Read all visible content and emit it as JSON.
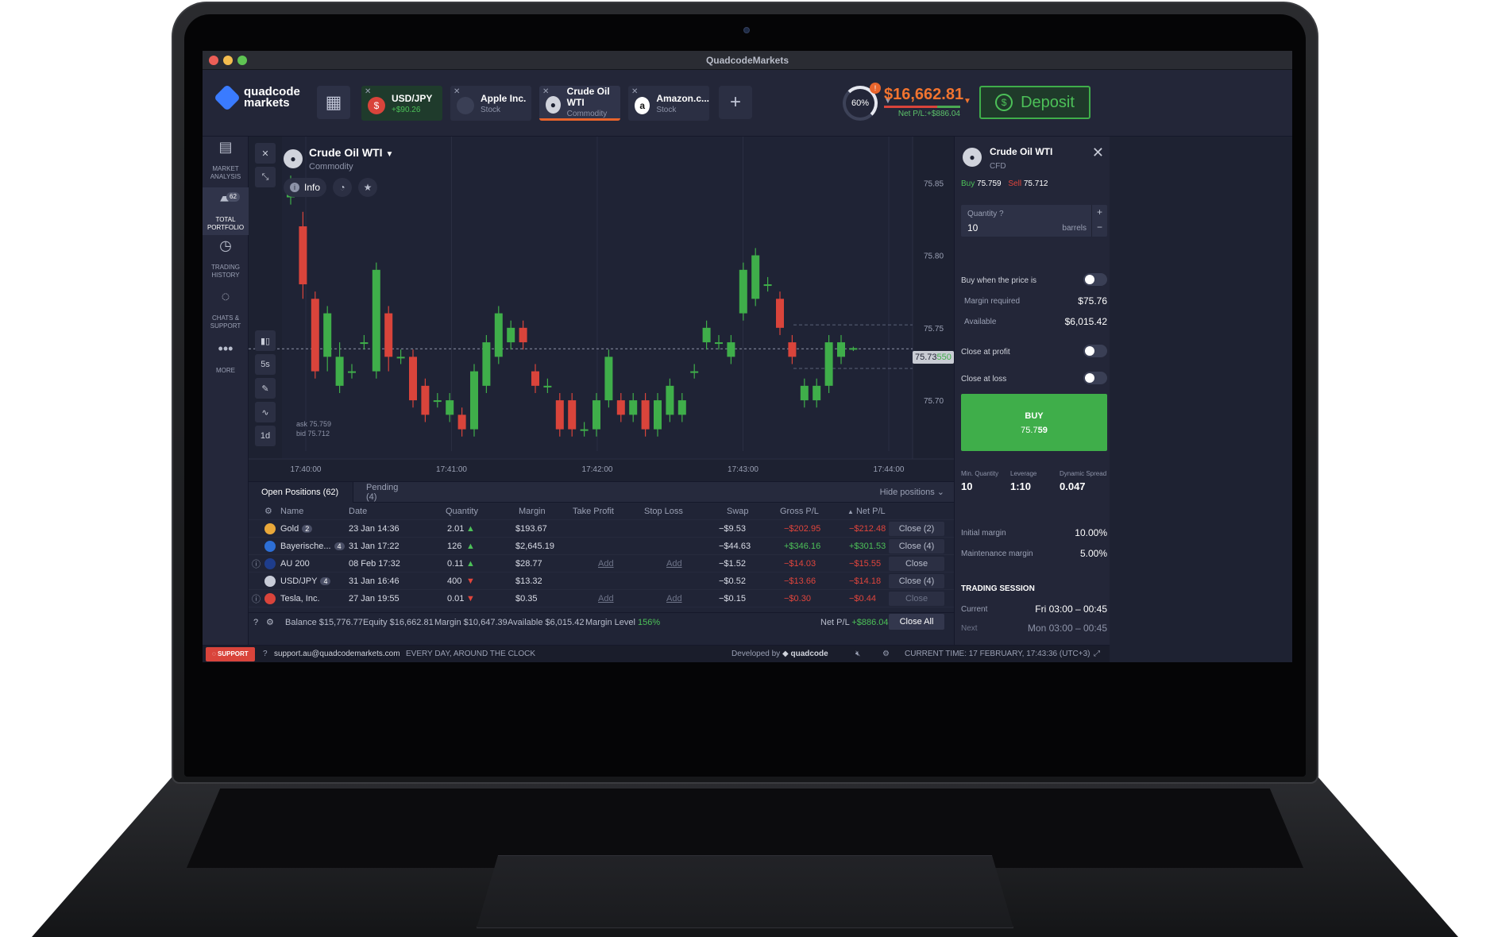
{
  "window": {
    "title": "QuadcodeMarkets"
  },
  "logo": {
    "line1": "quadcode",
    "line2": "markets"
  },
  "tabs": [
    {
      "name": "USD/JPY",
      "sub": "+$90.26",
      "icon": "flag-us-jp"
    },
    {
      "name": "Apple Inc.",
      "sub": "Stock",
      "icon": "apple-icon"
    },
    {
      "name": "Crude Oil WTI",
      "sub": "Commodity",
      "icon": "oil-drop-icon"
    },
    {
      "name": "Amazon.c...",
      "sub": "Stock",
      "icon": "amazon-icon"
    }
  ],
  "header": {
    "gauge": "60%",
    "gauge_badge": "!",
    "balance": "$16,662.81",
    "net_pl": "Net P/L:+$886.04",
    "deposit": "Deposit"
  },
  "sidebar": [
    {
      "label": "MARKET ANALYSIS",
      "icon": "newspaper-icon"
    },
    {
      "label": "TOTAL PORTFOLIO",
      "icon": "briefcase-icon",
      "badge": "62"
    },
    {
      "label": "TRADING HISTORY",
      "icon": "history-icon"
    },
    {
      "label": "CHATS & SUPPORT",
      "icon": "chat-icon"
    },
    {
      "label": "MORE",
      "icon": "more-icon"
    }
  ],
  "asset": {
    "name": "Crude Oil WTI",
    "category": "Commodity",
    "info": "Info"
  },
  "tools": {
    "candle_period": "5s",
    "timeframe": "1d"
  },
  "askbid": {
    "ask": "ask 75.759",
    "bid": "bid 75.712"
  },
  "price_tag": {
    "main": "75.73",
    "tail": "550"
  },
  "chart_data": {
    "type": "candlestick",
    "x_ticks": [
      "17:40:00",
      "17:41:00",
      "17:42:00",
      "17:43:00",
      "17:44:00"
    ],
    "y_ticks": [
      "75.85",
      "75.80",
      "75.75",
      "75.70"
    ],
    "ylim": [
      75.665,
      75.86
    ],
    "current_price": 75.7355,
    "candles": [
      {
        "o": 75.84,
        "c": 75.85,
        "h": 75.855,
        "l": 75.835
      },
      {
        "o": 75.82,
        "c": 75.78,
        "h": 75.83,
        "l": 75.77
      },
      {
        "o": 75.77,
        "c": 75.72,
        "h": 75.775,
        "l": 75.715
      },
      {
        "o": 75.73,
        "c": 75.76,
        "h": 75.765,
        "l": 75.72
      },
      {
        "o": 75.71,
        "c": 75.73,
        "h": 75.74,
        "l": 75.705
      },
      {
        "o": 75.72,
        "c": 75.72,
        "h": 75.725,
        "l": 75.715
      },
      {
        "o": 75.74,
        "c": 75.74,
        "h": 75.745,
        "l": 75.735
      },
      {
        "o": 75.72,
        "c": 75.79,
        "h": 75.795,
        "l": 75.715
      },
      {
        "o": 75.76,
        "c": 75.73,
        "h": 75.765,
        "l": 75.72
      },
      {
        "o": 75.73,
        "c": 75.73,
        "h": 75.735,
        "l": 75.725
      },
      {
        "o": 75.73,
        "c": 75.7,
        "h": 75.735,
        "l": 75.695
      },
      {
        "o": 75.71,
        "c": 75.69,
        "h": 75.715,
        "l": 75.685
      },
      {
        "o": 75.7,
        "c": 75.7,
        "h": 75.705,
        "l": 75.695
      },
      {
        "o": 75.69,
        "c": 75.7,
        "h": 75.705,
        "l": 75.685
      },
      {
        "o": 75.69,
        "c": 75.68,
        "h": 75.695,
        "l": 75.675
      },
      {
        "o": 75.68,
        "c": 75.72,
        "h": 75.725,
        "l": 75.675
      },
      {
        "o": 75.71,
        "c": 75.74,
        "h": 75.745,
        "l": 75.705
      },
      {
        "o": 75.73,
        "c": 75.76,
        "h": 75.765,
        "l": 75.725
      },
      {
        "o": 75.74,
        "c": 75.75,
        "h": 75.755,
        "l": 75.735
      },
      {
        "o": 75.75,
        "c": 75.74,
        "h": 75.755,
        "l": 75.735
      },
      {
        "o": 75.72,
        "c": 75.71,
        "h": 75.725,
        "l": 75.705
      },
      {
        "o": 75.71,
        "c": 75.71,
        "h": 75.715,
        "l": 75.705
      },
      {
        "o": 75.7,
        "c": 75.68,
        "h": 75.705,
        "l": 75.675
      },
      {
        "o": 75.7,
        "c": 75.68,
        "h": 75.705,
        "l": 75.675
      },
      {
        "o": 75.68,
        "c": 75.68,
        "h": 75.685,
        "l": 75.675
      },
      {
        "o": 75.68,
        "c": 75.7,
        "h": 75.705,
        "l": 75.675
      },
      {
        "o": 75.7,
        "c": 75.73,
        "h": 75.735,
        "l": 75.695
      },
      {
        "o": 75.7,
        "c": 75.69,
        "h": 75.705,
        "l": 75.685
      },
      {
        "o": 75.69,
        "c": 75.7,
        "h": 75.705,
        "l": 75.685
      },
      {
        "o": 75.7,
        "c": 75.68,
        "h": 75.705,
        "l": 75.675
      },
      {
        "o": 75.68,
        "c": 75.7,
        "h": 75.705,
        "l": 75.675
      },
      {
        "o": 75.69,
        "c": 75.71,
        "h": 75.715,
        "l": 75.685
      },
      {
        "o": 75.69,
        "c": 75.7,
        "h": 75.705,
        "l": 75.685
      },
      {
        "o": 75.72,
        "c": 75.72,
        "h": 75.725,
        "l": 75.715
      },
      {
        "o": 75.74,
        "c": 75.75,
        "h": 75.755,
        "l": 75.735
      },
      {
        "o": 75.74,
        "c": 75.74,
        "h": 75.745,
        "l": 75.735
      },
      {
        "o": 75.73,
        "c": 75.74,
        "h": 75.745,
        "l": 75.725
      },
      {
        "o": 75.76,
        "c": 75.79,
        "h": 75.795,
        "l": 75.755
      },
      {
        "o": 75.77,
        "c": 75.8,
        "h": 75.805,
        "l": 75.765
      },
      {
        "o": 75.78,
        "c": 75.78,
        "h": 75.785,
        "l": 75.775
      },
      {
        "o": 75.77,
        "c": 75.75,
        "h": 75.775,
        "l": 75.745
      },
      {
        "o": 75.74,
        "c": 75.73,
        "h": 75.745,
        "l": 75.725
      },
      {
        "o": 75.7,
        "c": 75.71,
        "h": 75.715,
        "l": 75.695
      },
      {
        "o": 75.7,
        "c": 75.71,
        "h": 75.715,
        "l": 75.695
      },
      {
        "o": 75.71,
        "c": 75.74,
        "h": 75.745,
        "l": 75.705
      },
      {
        "o": 75.73,
        "c": 75.74,
        "h": 75.745,
        "l": 75.725
      },
      {
        "o": 75.735,
        "c": 75.736,
        "h": 75.737,
        "l": 75.734
      }
    ]
  },
  "positions": {
    "tabs": [
      "Open Positions (62)",
      "Pending (4)"
    ],
    "hide": "Hide positions",
    "headers": [
      "Name",
      "Date",
      "Quantity",
      "Margin",
      "Take Profit",
      "Stop Loss",
      "Swap",
      "Gross P/L",
      "Net P/L"
    ],
    "rows": [
      {
        "name": "Gold",
        "badge": "2",
        "date": "23 Jan 14:36",
        "qty": "2.01",
        "dir": "up",
        "margin": "$193.67",
        "tp": "",
        "sl": "",
        "swap": "−$9.53",
        "gross": "−$202.95",
        "net": "−$212.48",
        "action": "Close (2)",
        "icon_color": "#e9a83a"
      },
      {
        "name": "Bayerische...",
        "badge": "4",
        "date": "31 Jan 17:22",
        "qty": "126",
        "dir": "up",
        "margin": "$2,645.19",
        "tp": "",
        "sl": "",
        "swap": "−$44.63",
        "gross": "+$346.16",
        "net": "+$301.53",
        "action": "Close (4)",
        "icon_color": "#2d6fd6"
      },
      {
        "name": "AU 200",
        "badge": "",
        "date": "08 Feb 17:32",
        "qty": "0.11",
        "dir": "up",
        "margin": "$28.77",
        "tp": "Add",
        "sl": "Add",
        "swap": "−$1.52",
        "gross": "−$14.03",
        "net": "−$15.55",
        "action": "Close",
        "icon_color": "#1e3d8c"
      },
      {
        "name": "USD/JPY",
        "badge": "4",
        "date": "31 Jan 16:46",
        "qty": "400",
        "dir": "down",
        "margin": "$13.32",
        "tp": "",
        "sl": "",
        "swap": "−$0.52",
        "gross": "−$13.66",
        "net": "−$14.18",
        "action": "Close (4)",
        "icon_color": "#c8ccd8"
      },
      {
        "name": "Tesla, Inc.",
        "badge": "",
        "date": "27 Jan 19:55",
        "qty": "0.01",
        "dir": "down",
        "margin": "$0.35",
        "tp": "Add",
        "sl": "Add",
        "swap": "−$0.15",
        "gross": "−$0.30",
        "net": "−$0.44",
        "action": "Close",
        "icon_color": "#d9443b"
      }
    ],
    "summary": {
      "balance": "Balance $15,776.77",
      "equity": "Equity $16,662.81",
      "margin": "Margin $10,647.39",
      "available": "Available $6,015.42",
      "margin_level_label": "Margin Level",
      "margin_level": "156%",
      "net_pl_label": "Net P/L",
      "net_pl": "+$886.04",
      "close_all": "Close All"
    }
  },
  "trade": {
    "name": "Crude Oil WTI",
    "sub": "CFD",
    "buy_label": "Buy",
    "buy_price": "75.759",
    "sell_label": "Sell",
    "sell_price": "75.712",
    "quantity_label": "Quantity",
    "quantity": "10",
    "unit": "barrels",
    "buy_when": "Buy when the price is",
    "margin_req_label": "Margin required",
    "margin_req": "$75.76",
    "available_label": "Available",
    "available": "$6,015.42",
    "close_profit": "Close at profit",
    "close_loss": "Close at loss",
    "buy_btn": "BUY",
    "buy_btn_price": "75.7",
    "buy_btn_price_tail": "59",
    "min_qty_label": "Min. Quantity",
    "min_qty": "10",
    "leverage_label": "Leverage",
    "leverage": "1:10",
    "spread_label": "Dynamic Spread",
    "spread": "0.047",
    "initial_margin_label": "Initial margin",
    "initial_margin": "10.00%",
    "maint_margin_label": "Maintenance margin",
    "maint_margin": "5.00%",
    "session_title": "TRADING SESSION",
    "current_label": "Current",
    "current": "Fri 03:00 – 00:45",
    "next_label": "Next",
    "next": "Mon 03:00 – 00:45"
  },
  "bottombar": {
    "support": "SUPPORT",
    "email": "support.au@quadcodemarkets.com",
    "hours": "EVERY DAY, AROUND THE CLOCK",
    "developed": "Developed by",
    "brand": "quadcode",
    "time": "CURRENT TIME: 17 FEBRUARY, 17:43:36 (UTC+3)"
  },
  "colors": {
    "up": "#3fae4a",
    "down": "#d9443b",
    "accent": "#e8642c"
  }
}
